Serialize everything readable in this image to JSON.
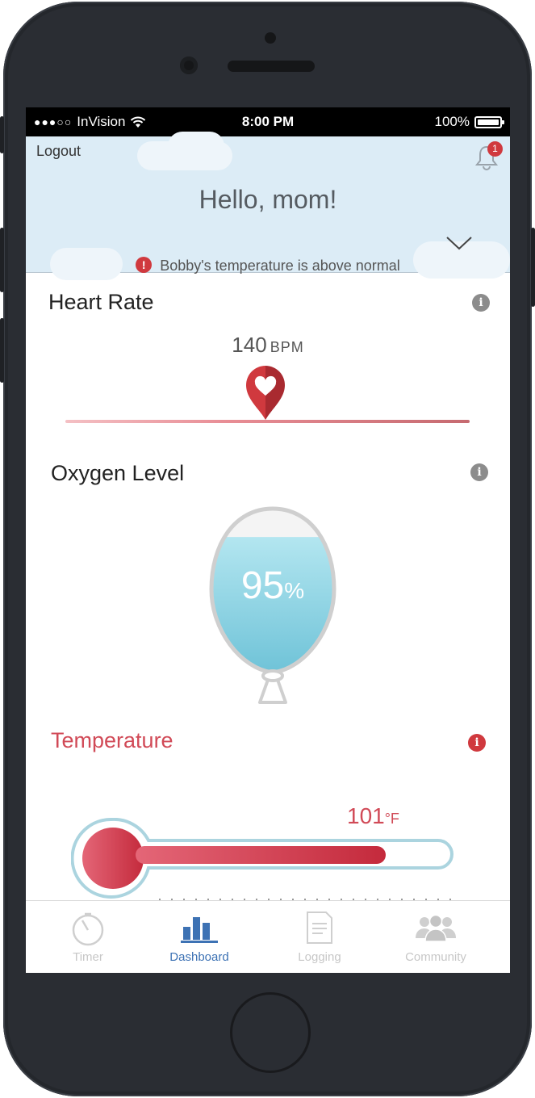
{
  "statusbar": {
    "signal_dots": "●●●○○",
    "carrier": "InVision",
    "time": "8:00 PM",
    "battery": "100%"
  },
  "header": {
    "logout_label": "Logout",
    "notification_count": "1",
    "greeting": "Hello, mom!",
    "alert_icon": "!",
    "alert_text": "Bobby's temperature is above normal"
  },
  "heart_rate": {
    "title": "Heart Rate",
    "value": "140",
    "unit": "BPM",
    "info_icon": "i"
  },
  "oxygen": {
    "title": "Oxygen Level",
    "value": "95",
    "unit": "%",
    "fill_percent": 95,
    "info_icon": "i"
  },
  "temperature": {
    "title": "Temperature",
    "value": "101",
    "unit": "°F",
    "info_icon": "i"
  },
  "tabs": [
    {
      "label": "Timer",
      "icon": "timer-icon"
    },
    {
      "label": "Dashboard",
      "icon": "dashboard-bars-icon"
    },
    {
      "label": "Logging",
      "icon": "document-icon"
    },
    {
      "label": "Community",
      "icon": "people-icon"
    }
  ],
  "colors": {
    "accent_blue": "#3d72b4",
    "alert_red": "#d0393e",
    "temperature_red": "#d14a57",
    "header_bg": "#dcecf6",
    "oxygen_fill": "#7ccbdd"
  }
}
